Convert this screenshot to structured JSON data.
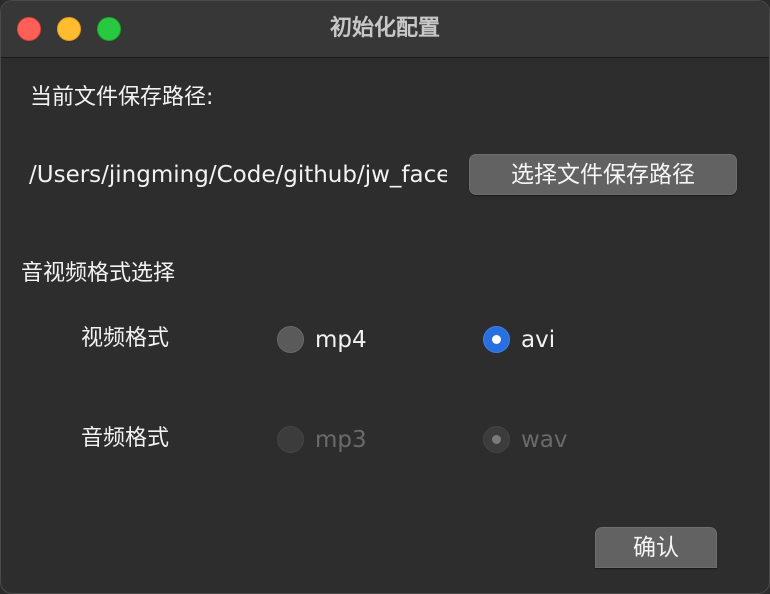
{
  "window": {
    "title": "初始化配置"
  },
  "save_path": {
    "label": "当前文件保存路径:",
    "value": "/Users/jingming/Code/github/jw_face",
    "button_label": "选择文件保存路径"
  },
  "format_section": {
    "heading": "音视频格式选择",
    "video": {
      "label": "视频格式",
      "options": [
        {
          "label": "mp4",
          "selected": false,
          "disabled": false
        },
        {
          "label": "avi",
          "selected": true,
          "disabled": false
        }
      ]
    },
    "audio": {
      "label": "音频格式",
      "options": [
        {
          "label": "mp3",
          "selected": false,
          "disabled": true
        },
        {
          "label": "wav",
          "selected": true,
          "disabled": true
        }
      ]
    }
  },
  "confirm_button": {
    "label": "确认"
  },
  "colors": {
    "background": "#2d2d2d",
    "titlebar": "#373737",
    "accent": "#2a6fe0",
    "button": "#626262"
  }
}
